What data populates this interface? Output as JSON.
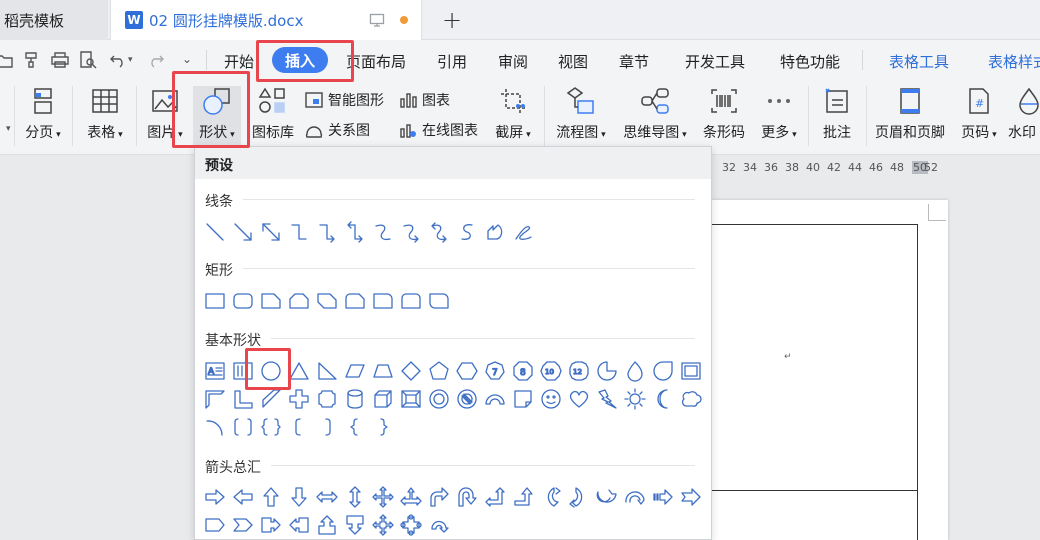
{
  "tabs": {
    "template_tab": "稻壳模板",
    "doc_icon": "W",
    "doc_tab": "02 圆形挂牌模版.docx",
    "add_tab": "+"
  },
  "menu": {
    "items": [
      "开始",
      "插入",
      "页面布局",
      "引用",
      "审阅",
      "视图",
      "章节",
      "开发工具",
      "特色功能"
    ],
    "table_tools": "表格工具",
    "table_style": "表格样式"
  },
  "ribbon": {
    "page_break": "分页",
    "table": "表格",
    "picture": "图片",
    "shapes": "形状",
    "icon_library": "图标库",
    "smart_art": "智能图形",
    "chart": "图表",
    "relation_map": "关系图",
    "online_chart": "在线图表",
    "screenshot": "截屏",
    "flowchart": "流程图",
    "mindmap": "思维导图",
    "barcode": "条形码",
    "more": "更多",
    "comment": "批注",
    "header_footer": "页眉和页脚",
    "page_number": "页码",
    "watermark": "水印"
  },
  "ruler": [
    "32",
    "34",
    "36",
    "38",
    "40",
    "42",
    "44",
    "46",
    "48",
    "50",
    "52"
  ],
  "dropdown": {
    "header": "预设",
    "sections": {
      "lines": "线条",
      "rectangles": "矩形",
      "basic_shapes": "基本形状",
      "arrows": "箭头总汇"
    },
    "shape_numbers": [
      "7",
      "8",
      "10",
      "12"
    ],
    "text_box_label": "A"
  },
  "colors": {
    "accent": "#3e7df0",
    "highlight": "#e8454d",
    "shape_stroke": "#3e6fc4"
  }
}
